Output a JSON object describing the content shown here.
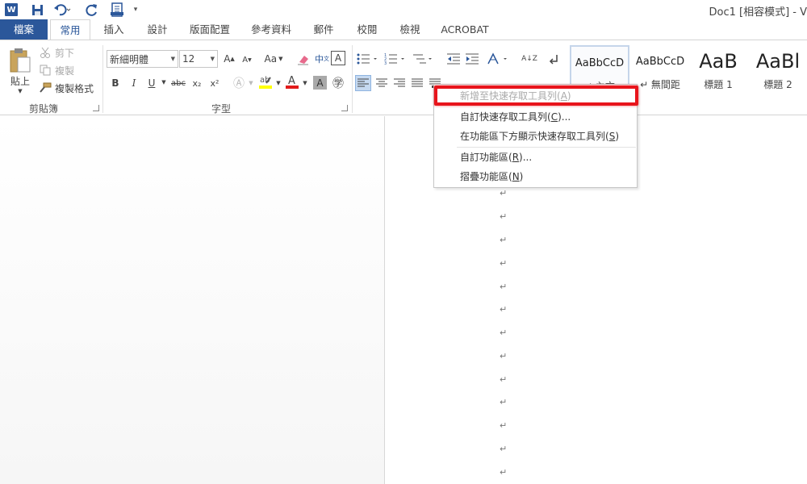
{
  "titlebar": {
    "app_logo": "W",
    "title": "Doc1 [相容模式] - V",
    "qat_more": "▾"
  },
  "tabs": {
    "file": "檔案",
    "items": [
      "常用",
      "插入",
      "設計",
      "版面配置",
      "參考資料",
      "郵件",
      "校閱",
      "檢視",
      "ACROBAT"
    ]
  },
  "clipboard": {
    "paste": "貼上",
    "cut": "剪下",
    "copy": "複製",
    "format_painter": "複製格式",
    "group_label": "剪貼簿"
  },
  "font": {
    "name": "新細明體",
    "size": "12",
    "aa_label": "Aa",
    "bold": "B",
    "italic": "I",
    "underline": "U",
    "strike": "abc",
    "subscript": "x₂",
    "superscript": "x²",
    "group_label": "字型"
  },
  "paragraph": {
    "sort_label": "A↓Z"
  },
  "styles": {
    "items": [
      {
        "sample": "AaBbCcD",
        "name": "↵ 內文"
      },
      {
        "sample": "AaBbCcD",
        "name": "↵ 無間距"
      },
      {
        "sample": "AaB",
        "name": "標題 1"
      },
      {
        "sample": "AaBl",
        "name": "標題 2"
      }
    ]
  },
  "context_menu": {
    "items": [
      {
        "text": "新增至快速存取工具列(",
        "key": "A",
        "suffix": ")",
        "disabled": true
      },
      {
        "text": "自訂快速存取工具列(",
        "key": "C",
        "suffix": ")...",
        "disabled": false
      },
      {
        "text": "在功能區下方顯示快速存取工具列(",
        "key": "S",
        "suffix": ")",
        "disabled": false
      },
      {
        "text": "自訂功能區(",
        "key": "R",
        "suffix": ")...",
        "disabled": false
      },
      {
        "text": "摺疊功能區(",
        "key": "N",
        "suffix": ")",
        "disabled": false
      }
    ]
  },
  "document": {
    "paragraph_mark": "↵"
  },
  "colors": {
    "word_blue": "#2b579a",
    "highlight_red": "#e8141b"
  }
}
